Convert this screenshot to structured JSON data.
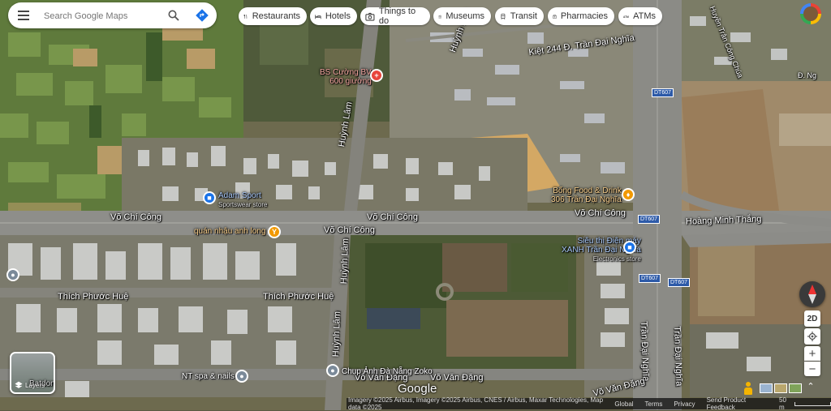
{
  "search": {
    "placeholder": "Search Google Maps"
  },
  "chips": [
    {
      "label": "Restaurants",
      "icon": "fork-knife-icon"
    },
    {
      "label": "Hotels",
      "icon": "bed-icon"
    },
    {
      "label": "Things to do",
      "icon": "camera-icon"
    },
    {
      "label": "Museums",
      "icon": "museum-icon"
    },
    {
      "label": "Transit",
      "icon": "train-icon"
    },
    {
      "label": "Pharmacies",
      "icon": "pharmacy-icon"
    },
    {
      "label": "ATMs",
      "icon": "atm-icon"
    }
  ],
  "streets": {
    "vo_chi_cong_1": "Võ Chí Công",
    "vo_chi_cong_2": "Võ Chí Công",
    "vo_chi_cong_3": "Võ Chí Công",
    "vo_chi_cong_4": "Võ Chí Công",
    "huynh_lam_1": "Huỳnh Lâm",
    "huynh_lam_2": "Huỳnh Lâm",
    "huynh_lam_3": "Huỳnh Lâm",
    "huynh_lam_4": "Huỳnh Lâm",
    "thich_phuoc_hue_1": "Thích Phước Huệ",
    "thich_phuoc_hue_2": "Thích Phước Huệ",
    "kiet": "Kiệt 244 Đ. Trần Đại Nghĩa",
    "hoang_minh_thang": "Hoàng Minh Thắng",
    "tran_dai_nghia_1": "Trần Đại Nghĩa",
    "tran_dai_nghia_2": "Trần Đại Nghĩa",
    "vo_van_dang_1": "Võ Văn Đặng",
    "vo_van_dang_2": "Võ Văn Đặng",
    "vo_van_dang_3": "Võ Văn Đặng",
    "huyen_tran": "Huyền Trân Công Chúa",
    "d_ng": "Đ. Ng"
  },
  "route_shields": {
    "dt607_1": "DT607",
    "dt607_2": "DT607",
    "dt607_3": "DT607",
    "dt607_4": "DT607"
  },
  "pois": {
    "bs_cuong": "BS Cường BV",
    "bs_cuong_2": "600 giường",
    "adam_sport": "Adam Sport",
    "adam_sport_2": "Sportswear store",
    "bong_food": "Bống Food & Drink",
    "bong_food_2": "306 Trần Đại Nghĩa",
    "quan_nhau": "quán nhậu anh long",
    "sieu_thi": "Siêu thị Điện máy",
    "sieu_thi_2": "XANH Trần Đại Nghĩa",
    "sieu_thi_3": "Electronics store",
    "chup_anh": "Chụp Ảnh Đà Nẵng Zoko",
    "nt_spa": "NT spa & nails",
    "batdongsan": "Batdongsan"
  },
  "layers": {
    "label": "Layers"
  },
  "view_toggle": "2D",
  "logo": "Google",
  "footer": {
    "imagery": "Imagery ©2025 Airbus, Imagery ©2025 Airbus, CNES / Airbus, Maxar Technologies, Map data ©2025",
    "global": "Global",
    "terms": "Terms",
    "privacy": "Privacy",
    "feedback": "Send Product Feedback",
    "scale": "50 m"
  },
  "colors": {
    "accent": "#1a73e8",
    "food_pin": "#f29900",
    "shop_pin": "#1a73e8",
    "health_pin": "#e8453c",
    "place_pin": "#7b8a99"
  }
}
